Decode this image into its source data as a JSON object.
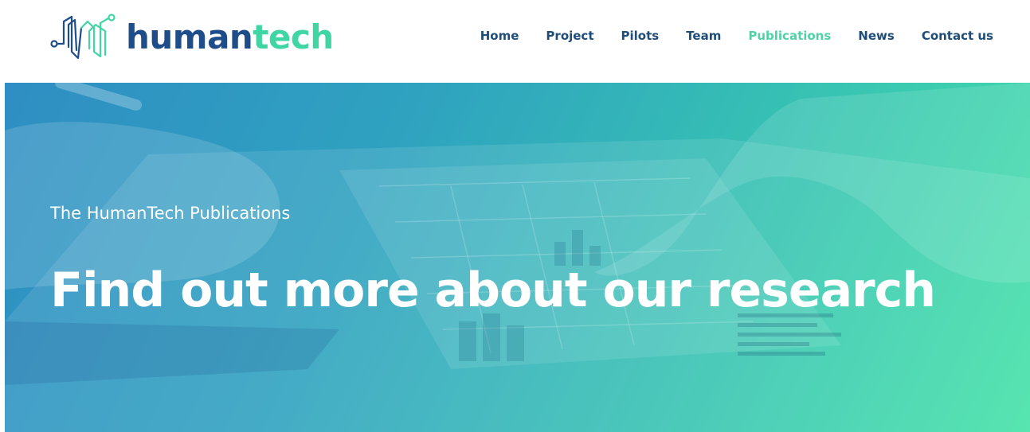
{
  "brand": {
    "name_part1": "human",
    "name_part2": "tech",
    "color_primary": "#1f4d8a",
    "color_accent": "#3fd6a3",
    "logo_icon": "humantech-logo-icon"
  },
  "nav": {
    "items": [
      {
        "label": "Home"
      },
      {
        "label": "Project"
      },
      {
        "label": "Pilots"
      },
      {
        "label": "Team"
      },
      {
        "label": "Publications",
        "active": true
      },
      {
        "label": "News"
      },
      {
        "label": "Contact us"
      }
    ]
  },
  "hero": {
    "kicker": "The HumanTech Publications",
    "title": "Find out more about our research",
    "gradient_start": "#2f8ec3",
    "gradient_end": "#44e2a8"
  }
}
